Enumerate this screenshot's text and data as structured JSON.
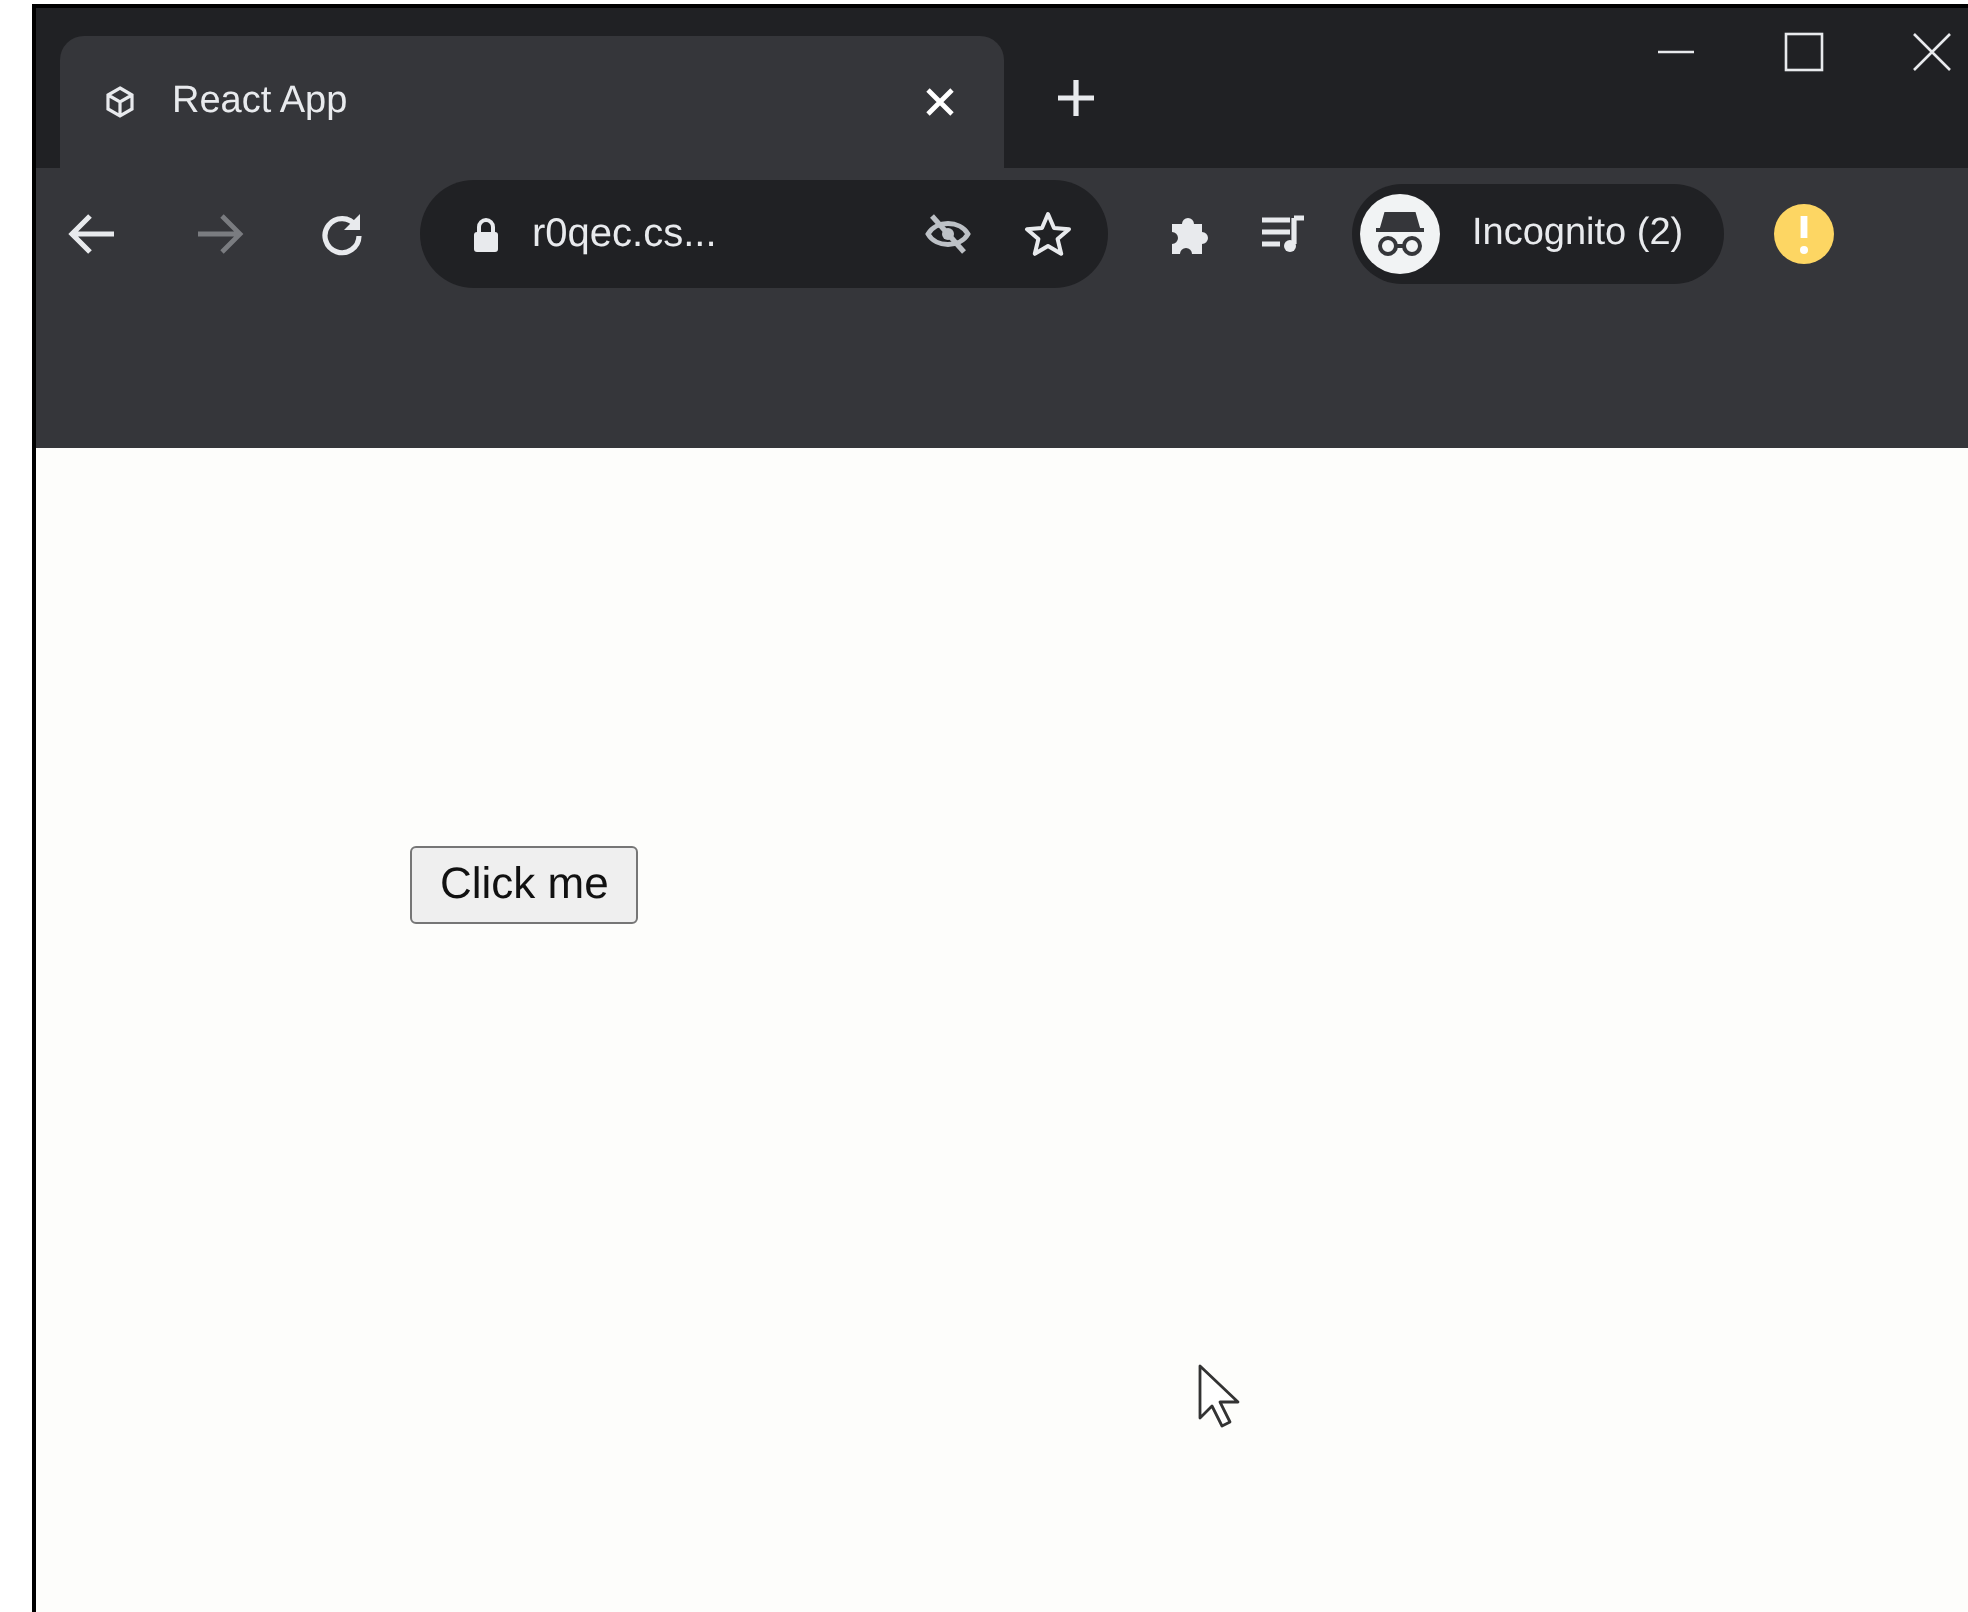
{
  "tabs": [
    {
      "title": "React App",
      "selected": true
    }
  ],
  "toolbar": {
    "forward_disabled": true,
    "address": "r0qec.cs...",
    "bookmarked": false,
    "profile": "Incognito (2)"
  },
  "page": {
    "button": "Click me"
  }
}
